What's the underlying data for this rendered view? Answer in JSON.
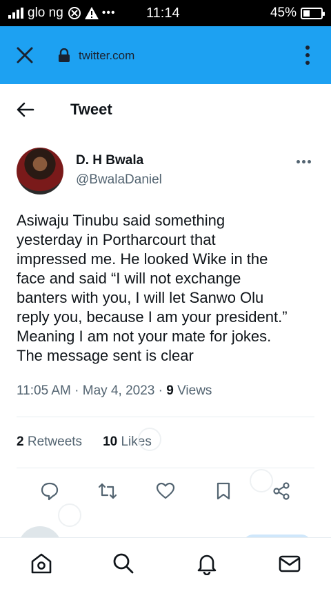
{
  "status_bar": {
    "carrier": "glo ng",
    "time": "11:14",
    "battery": "45%",
    "battery_level": 0.45
  },
  "browser": {
    "url": "twitter.com"
  },
  "header": {
    "title": "Tweet"
  },
  "tweet": {
    "author_name": "D. H Bwala",
    "author_handle": "@BwalaDaniel",
    "text": "Asiwaju Tinubu said something\nyesterday in Portharcourt that\nimpressed me. He looked Wike in the\nface and said “I will not exchange\nbanters with you, I will let Sanwo Olu\nreply you, because I am your president.”\nMeaning I am not your mate for jokes.\nThe message sent is clear",
    "time": "11:05 AM",
    "date": "May 4, 2023",
    "views_count": "9",
    "views_label": "Views",
    "retweets_count": "2",
    "retweets_label": "Retweets",
    "likes_count": "10",
    "likes_label": "Likes"
  },
  "colors": {
    "brand": "#1da1f2",
    "text": "#0f1419",
    "muted": "#536471"
  }
}
